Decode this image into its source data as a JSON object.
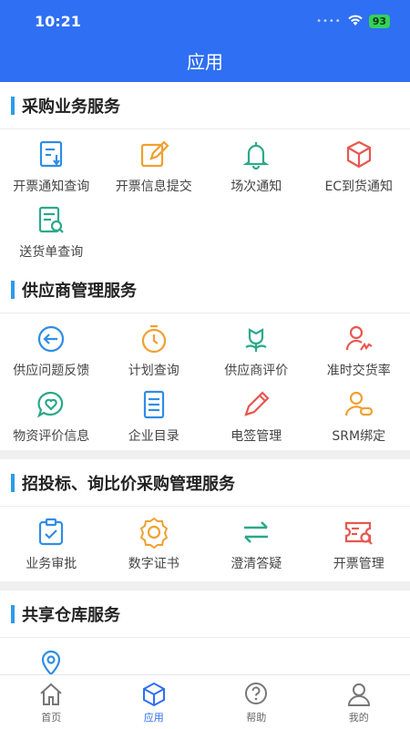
{
  "status_bar": {
    "time": "10:21",
    "battery": "93"
  },
  "header": {
    "title": "应用"
  },
  "sections": [
    {
      "title": "采购业务服务",
      "items": [
        {
          "label": "开票通知查询",
          "icon": "invoice-notice-icon"
        },
        {
          "label": "开票信息提交",
          "icon": "edit-icon"
        },
        {
          "label": "场次通知",
          "icon": "bell-icon"
        },
        {
          "label": "EC到货通知",
          "icon": "box-icon"
        },
        {
          "label": "送货单查询",
          "icon": "document-search-icon"
        }
      ]
    },
    {
      "title": "供应商管理服务",
      "items": [
        {
          "label": "供应问题反馈",
          "icon": "feedback-icon"
        },
        {
          "label": "计划查询",
          "icon": "stopwatch-icon"
        },
        {
          "label": "供应商评价",
          "icon": "flower-icon"
        },
        {
          "label": "准时交货率",
          "icon": "person-sign-icon"
        },
        {
          "label": "物资评价信息",
          "icon": "heart-chat-icon"
        },
        {
          "label": "企业目录",
          "icon": "list-document-icon"
        },
        {
          "label": "电签管理",
          "icon": "pen-icon"
        },
        {
          "label": "SRM绑定",
          "icon": "user-link-icon"
        }
      ]
    },
    {
      "title": "招投标、询比价采购管理服务",
      "items": [
        {
          "label": "业务审批",
          "icon": "clipboard-check-icon"
        },
        {
          "label": "数字证书",
          "icon": "badge-icon"
        },
        {
          "label": "澄清答疑",
          "icon": "exchange-icon"
        },
        {
          "label": "开票管理",
          "icon": "ticket-search-icon"
        }
      ]
    },
    {
      "title": "共享仓库服务",
      "items": [
        {
          "label": "",
          "icon": "location-icon"
        }
      ]
    }
  ],
  "tabbar": [
    {
      "label": "首页",
      "icon": "home-icon",
      "active": false
    },
    {
      "label": "应用",
      "icon": "cube-icon",
      "active": true
    },
    {
      "label": "帮助",
      "icon": "help-icon",
      "active": false
    },
    {
      "label": "我的",
      "icon": "user-icon",
      "active": false
    }
  ],
  "colors": {
    "primary": "#2f6ff3",
    "blue": "#2f8de4",
    "orange": "#f0a030",
    "teal": "#2aa88a",
    "red": "#e8574f"
  }
}
